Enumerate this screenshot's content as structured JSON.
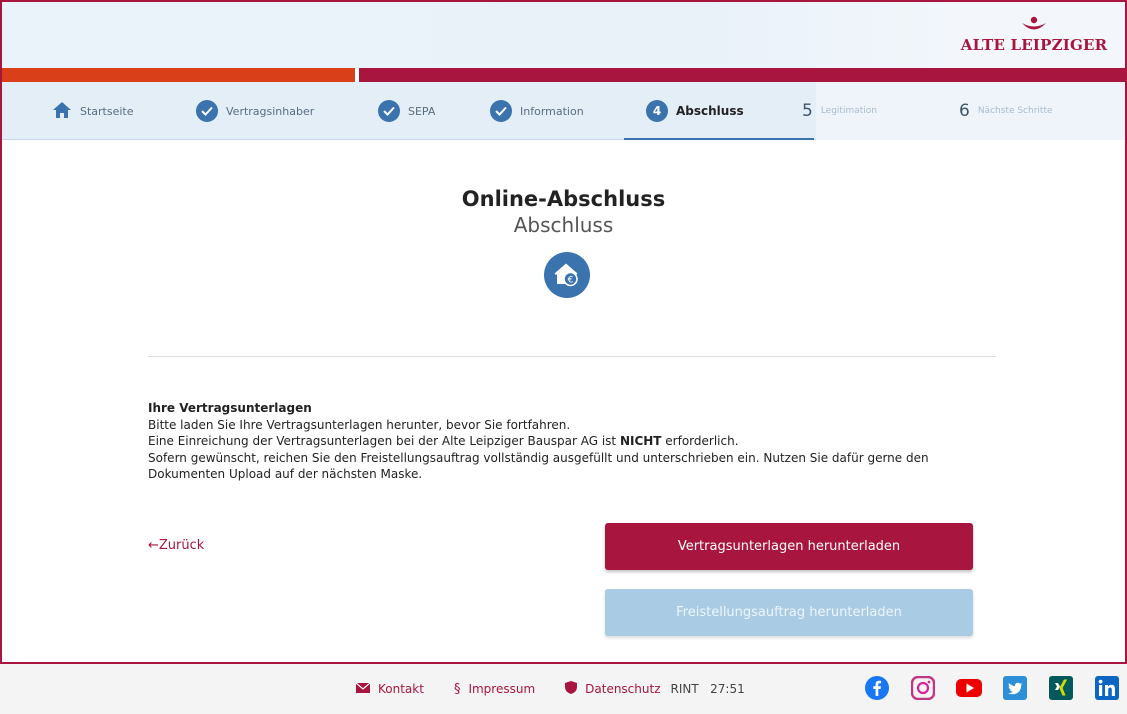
{
  "brand": {
    "name": "ALTE LEIPZIGER",
    "color": "#a8163f",
    "accent_orange": "#d9401a",
    "step_blue": "#3a73ad"
  },
  "steps": [
    {
      "label": "Startseite",
      "icon": "home-icon",
      "state": "done"
    },
    {
      "label": "Vertragsinhaber",
      "icon": "check-circle-icon",
      "state": "done"
    },
    {
      "label": "SEPA",
      "icon": "check-circle-icon",
      "state": "done"
    },
    {
      "label": "Information",
      "icon": "check-circle-icon",
      "state": "done"
    },
    {
      "number": "4",
      "label": "Abschluss",
      "state": "active"
    },
    {
      "number": "5",
      "label": "Legitimation",
      "state": "future"
    },
    {
      "number": "6",
      "label": "Nächste Schritte",
      "state": "future"
    }
  ],
  "page": {
    "title": "Online-Abschluss",
    "subtitle": "Abschluss",
    "badge_icon": "house-euro-icon"
  },
  "content": {
    "heading": "Ihre Vertragsunterlagen",
    "line1": "Bitte laden Sie Ihre Vertragsunterlagen herunter, bevor Sie fortfahren.",
    "line2_before": "Eine Einreichung der Vertragsunterlagen bei der Alte Leipziger Bauspar AG ist ",
    "line2_bold": "NICHT",
    "line2_after": " erforderlich.",
    "line3": "Sofern gewünscht, reichen Sie den Freistellungsauftrag vollständig ausgefüllt und unterschrieben ein. Nutzen Sie dafür gerne den Dokumenten Upload auf der nächsten Maske."
  },
  "actions": {
    "back": "←Zurück",
    "download_contract": "Vertragsunterlagen herunterladen",
    "download_exemption": "Freistellungsauftrag herunterladen"
  },
  "footer": {
    "contact": "Kontakt",
    "imprint_symbol": "§",
    "imprint": "Impressum",
    "privacy": "Datenschutz",
    "env": "RINT",
    "timer": "27:51",
    "socials": [
      "facebook-icon",
      "instagram-icon",
      "youtube-icon",
      "twitter-icon",
      "xing-icon",
      "linkedin-icon"
    ]
  }
}
